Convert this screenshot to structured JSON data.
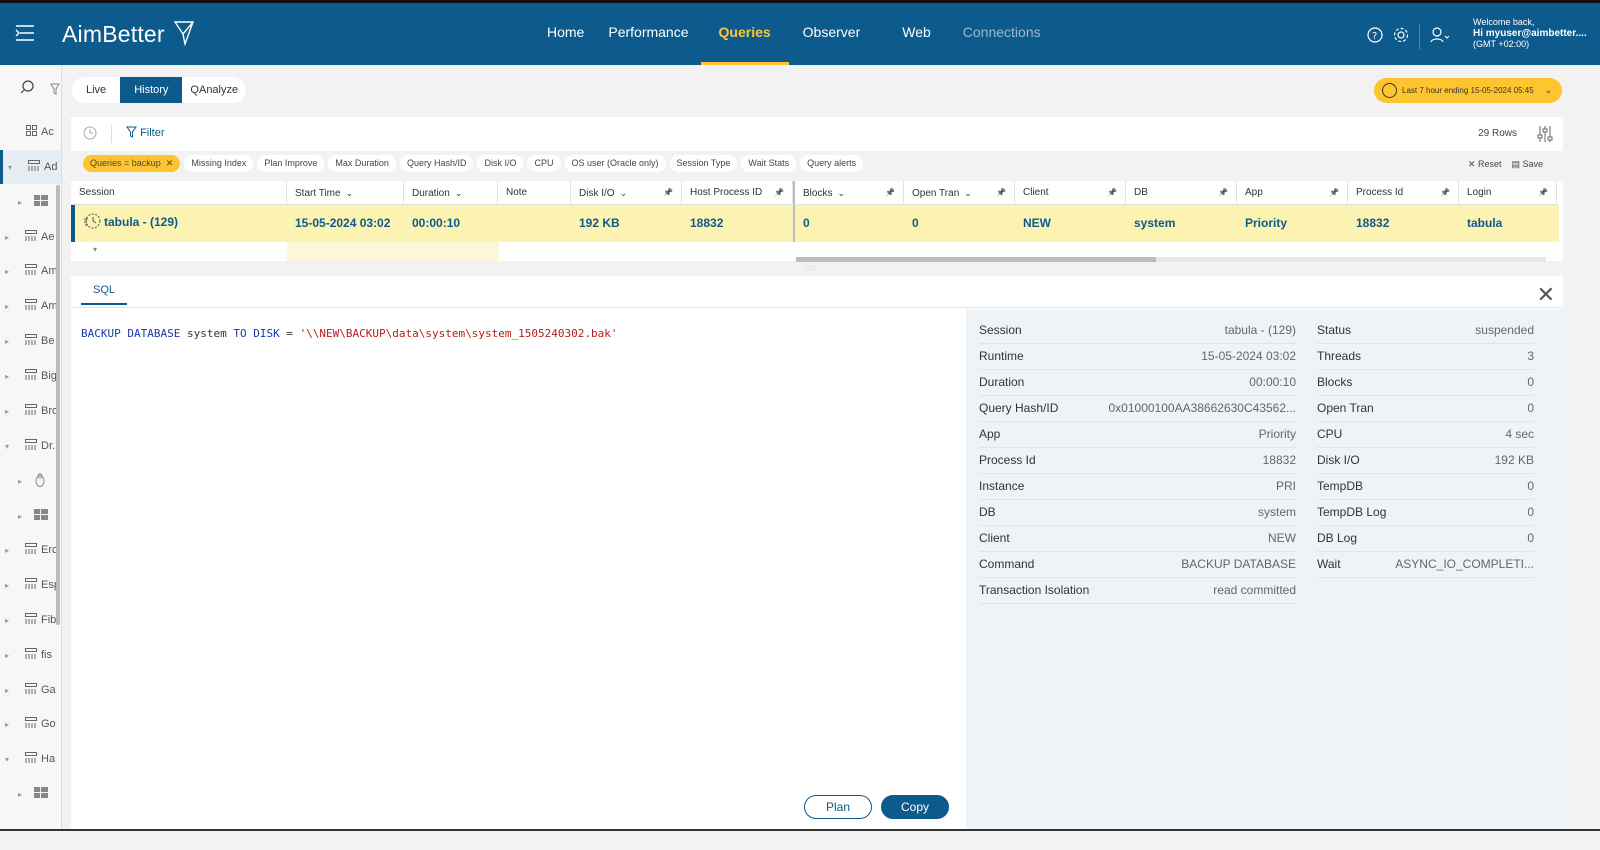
{
  "header": {
    "brand": "AimBetter",
    "nav": [
      "Home",
      "Performance",
      "Queries",
      "Observer",
      "Web",
      "Connections"
    ],
    "active_nav": "Queries",
    "welcome": "Welcome back,",
    "user": "Hi myuser@aimbetter....",
    "tz": "(GMT +02:00)"
  },
  "sidebar": {
    "items": [
      "Ac",
      "Ad",
      "",
      "Ae",
      "Am",
      "Am",
      "Be",
      "Big",
      "Bro",
      "Dr.",
      "",
      "",
      "Erc",
      "Esp",
      "Fib",
      "fis",
      "Ga",
      "Go",
      "Ha",
      ""
    ]
  },
  "mode_tabs": [
    "Live",
    "History",
    "QAnalyze"
  ],
  "time_range": "Last 7 hour ending  15-05-2024 05:45",
  "toolbar": {
    "filter": "Filter",
    "rows": "29 Rows"
  },
  "chips": [
    "Queries = backup",
    "Missing Index",
    "Plan Improve",
    "Max Duration",
    "Query Hash/ID",
    "Disk I/O",
    "CPU",
    "OS user (Oracle only)",
    "Session Type",
    "Wait Stats",
    "Query alerts"
  ],
  "chip_actions": {
    "reset": "Reset",
    "save": "Save"
  },
  "grid": {
    "columns": [
      "Session",
      "Start Time",
      "Duration",
      "Note",
      "Disk I/O",
      "Host Process ID",
      "Blocks",
      "Open Tran",
      "Client",
      "DB",
      "App",
      "Process Id",
      "Login"
    ],
    "row": [
      "tabula - (129)",
      "15-05-2024 03:02",
      "00:00:10",
      "",
      "192 KB",
      "18832",
      "0",
      "0",
      "NEW",
      "system",
      "Priority",
      "18832",
      "tabula"
    ]
  },
  "detail": {
    "tab": "SQL",
    "sql": {
      "kw1": "BACKUP DATABASE",
      "db": " system ",
      "kw2": "TO DISK",
      "eq": " = ",
      "path": "'\\\\NEW\\BACKUP\\data\\system\\system_1505240302.bak'"
    },
    "plan": "Plan",
    "copy": "Copy",
    "info_left": [
      {
        "k": "Session",
        "v": "tabula - (129)"
      },
      {
        "k": "Runtime",
        "v": "15-05-2024 03:02"
      },
      {
        "k": "Duration",
        "v": "00:00:10"
      },
      {
        "k": "Query Hash/ID",
        "v": "0x01000100AA38662630C43562..."
      },
      {
        "k": "App",
        "v": "Priority"
      },
      {
        "k": "Process Id",
        "v": "18832"
      },
      {
        "k": "Instance",
        "v": "PRI"
      },
      {
        "k": "DB",
        "v": "system"
      },
      {
        "k": "Client",
        "v": "NEW"
      },
      {
        "k": "Command",
        "v": "BACKUP DATABASE"
      },
      {
        "k": "Transaction Isolation",
        "v": "read committed"
      }
    ],
    "info_right": [
      {
        "k": "Status",
        "v": "suspended"
      },
      {
        "k": "Threads",
        "v": "3"
      },
      {
        "k": "Blocks",
        "v": "0"
      },
      {
        "k": "Open Tran",
        "v": "0"
      },
      {
        "k": "CPU",
        "v": "4 sec"
      },
      {
        "k": "Disk I/O",
        "v": "192 KB"
      },
      {
        "k": "TempDB",
        "v": "0"
      },
      {
        "k": "TempDB Log",
        "v": "0"
      },
      {
        "k": "DB Log",
        "v": "0"
      },
      {
        "k": "Wait",
        "v": "ASYNC_IO_COMPLETI..."
      }
    ]
  }
}
